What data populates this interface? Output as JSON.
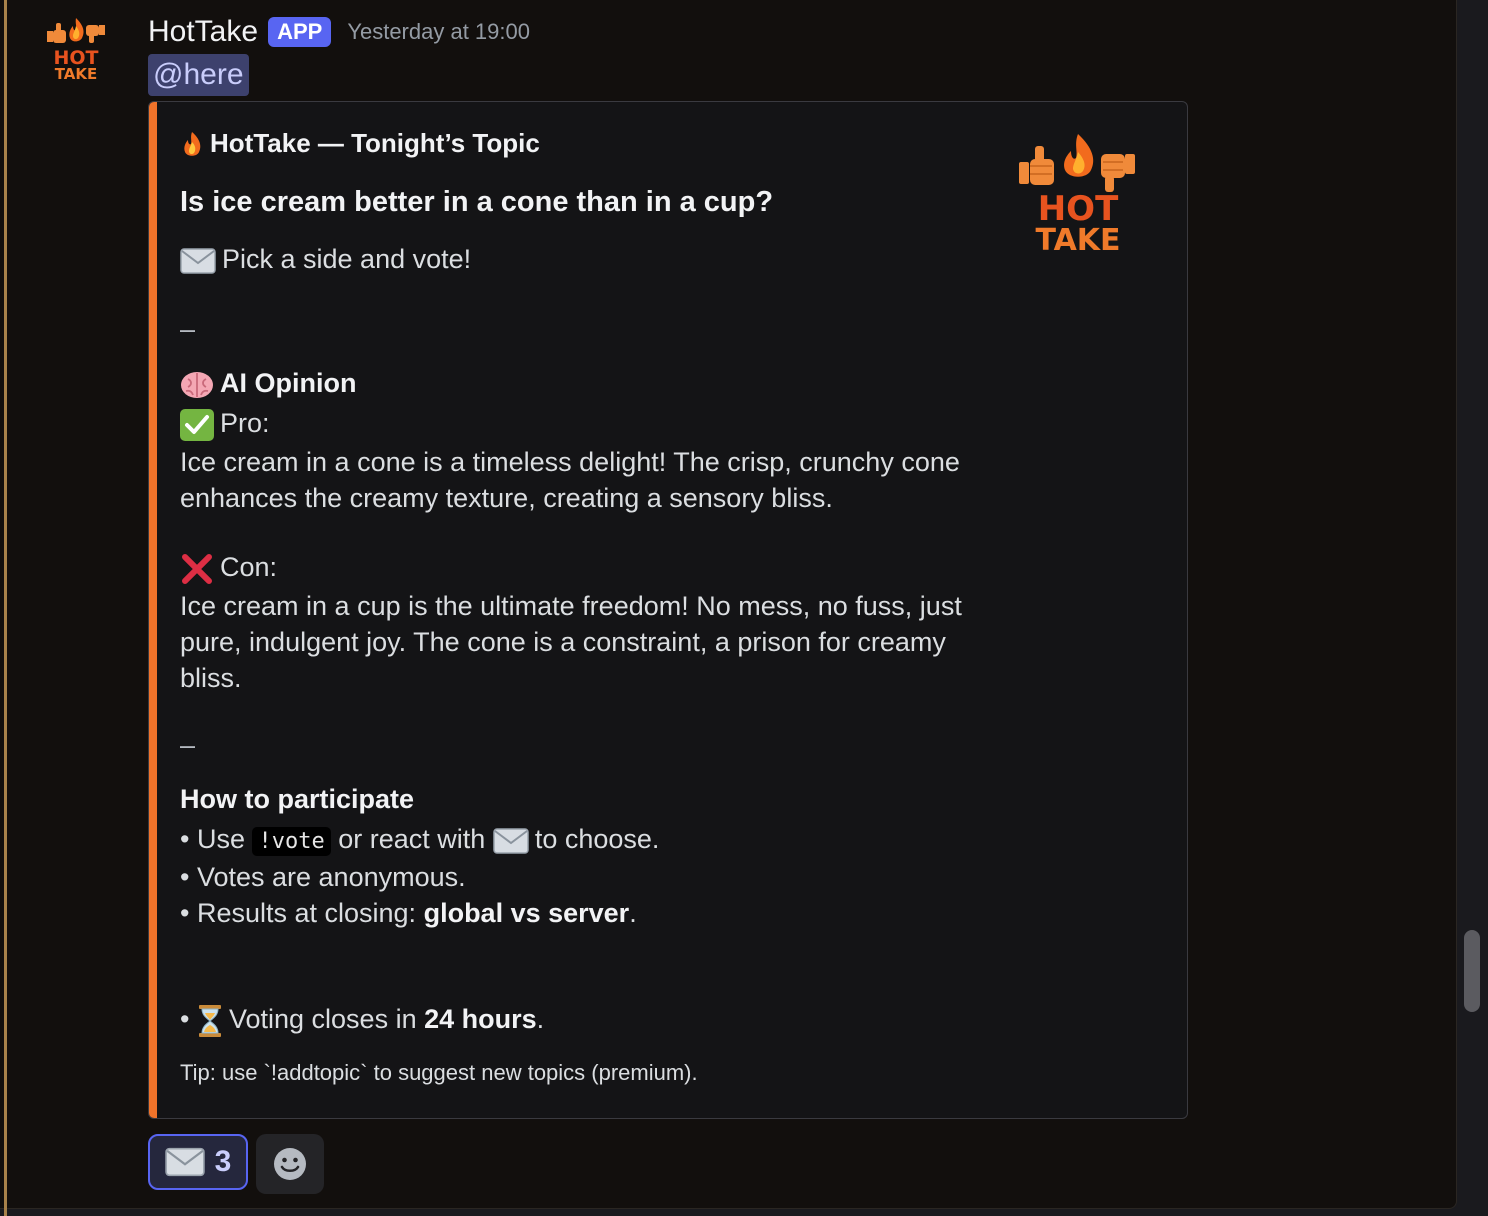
{
  "message": {
    "author": "HotTake",
    "badge": "APP",
    "timestamp": "Yesterday at 19:00",
    "mention": "@here"
  },
  "embed": {
    "title": "HotTake — Tonight’s Topic",
    "question": "Is ice cream better in a cone than in a cup?",
    "pick_line": "Pick a side and vote!",
    "separator": "–",
    "ai_opinion_label": "AI Opinion",
    "pro_label": "Pro:",
    "pro_text": "Ice cream in a cone is a timeless delight! The crisp, crunchy cone enhances the creamy texture, creating a sensory bliss.",
    "con_label": "Con:",
    "con_text": "Ice cream in a cup is the ultimate freedom! No mess, no fuss, just pure, indulgent joy. The cone is a constraint, a prison for creamy bliss.",
    "how_to_title": "How to participate",
    "bullet_1_prefix": "• Use",
    "bullet_1_code": "!vote",
    "bullet_1_middle": "or react with",
    "bullet_1_suffix": "to choose.",
    "bullet_2": "• Votes are anonymous.",
    "bullet_3_prefix": "• Results at closing:",
    "bullet_3_bold": "global vs server",
    "bullet_3_suffix": ".",
    "closing_bullet": "•",
    "closing_prefix": "Voting closes in",
    "closing_bold": "24 hours",
    "closing_suffix": ".",
    "tip": "Tip: use `!addtopic` to suggest new topics (premium).",
    "logo_text_1": "HOT",
    "logo_text_2": "TAKE",
    "accent_color": "#f0732a"
  },
  "reactions": [
    {
      "icon": "envelope-icon",
      "count": "3"
    }
  ],
  "icons": {
    "fire": "fire-icon",
    "envelope": "envelope-icon",
    "brain": "brain-icon",
    "check": "check-icon",
    "cross": "cross-icon",
    "hourglass": "hourglass-icon",
    "add_reaction": "smiley-icon"
  }
}
